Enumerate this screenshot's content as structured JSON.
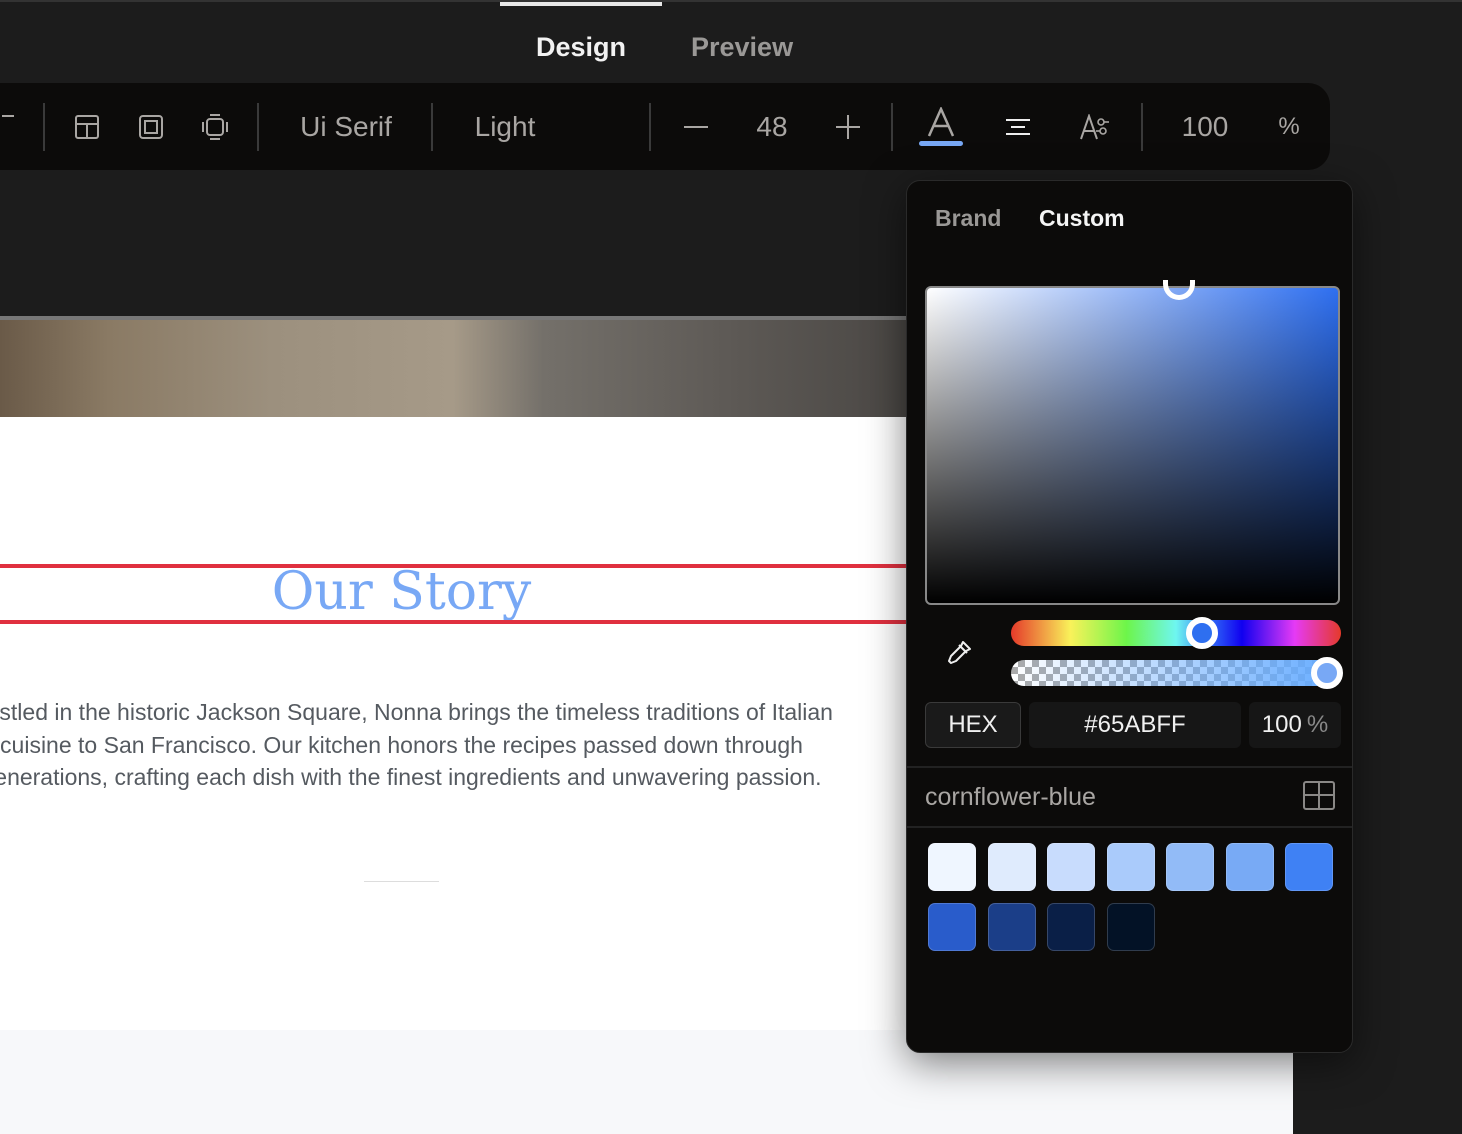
{
  "header": {
    "tabs": [
      {
        "label": "Design",
        "active": true
      },
      {
        "label": "Preview",
        "active": false
      }
    ]
  },
  "toolbar": {
    "font_family": "Ui Serif",
    "font_weight": "Light",
    "font_size": "48",
    "decrease_icon": "minus-icon",
    "increase_icon": "plus-icon",
    "opacity": "100",
    "opacity_unit": "%",
    "text_color_accent": "#78a8f5"
  },
  "canvas": {
    "heading": "Our Story",
    "paragraph": "Nestled in the historic Jackson Square, Nonna brings the timeless traditions of Italian cuisine to San Francisco. Our kitchen honors the recipes passed down through generations, crafting each dish with the finest ingredients and unwavering passion."
  },
  "color_picker": {
    "tabs": [
      {
        "label": "Brand",
        "active": false
      },
      {
        "label": "Custom",
        "active": true
      }
    ],
    "hue_percent": 58,
    "alpha_percent": 100,
    "format": "HEX",
    "hex_value": "#65ABFF",
    "alpha_value": "100",
    "alpha_unit": "%",
    "palette_name": "cornflower-blue",
    "swatches": [
      "#eff6ff",
      "#dfebfd",
      "#c8dcfd",
      "#aacbfb",
      "#92bbf7",
      "#78aaf5",
      "#3f81f4",
      "#295ccb",
      "#1b3e88",
      "#0a1f47",
      "#031226"
    ]
  }
}
